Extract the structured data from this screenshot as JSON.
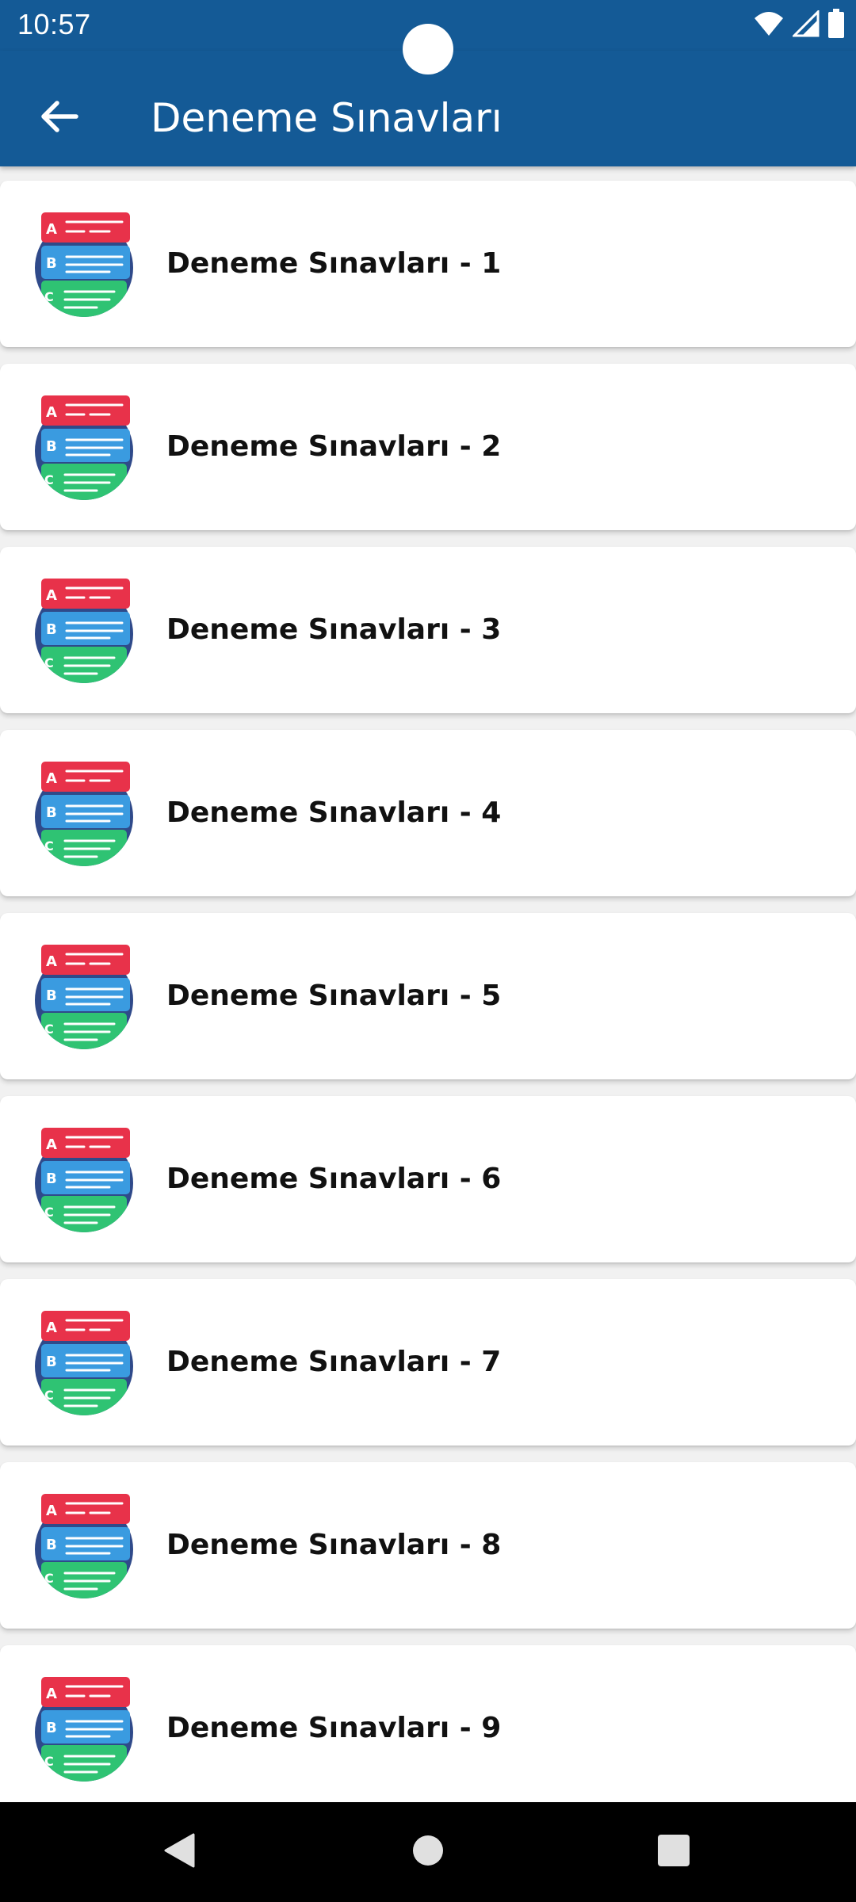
{
  "status_bar": {
    "time": "10:57",
    "icons": [
      "wifi-icon",
      "cell-signal-icon",
      "battery-icon"
    ]
  },
  "app_bar": {
    "title": "Deneme Sınavları",
    "back_icon": "arrow-left-icon",
    "background_color": "#145a96"
  },
  "list": {
    "items": [
      {
        "label": "Deneme Sınavları - 1",
        "icon": "quiz-abc-icon"
      },
      {
        "label": "Deneme Sınavları - 2",
        "icon": "quiz-abc-icon"
      },
      {
        "label": "Deneme Sınavları - 3",
        "icon": "quiz-abc-icon"
      },
      {
        "label": "Deneme Sınavları - 4",
        "icon": "quiz-abc-icon"
      },
      {
        "label": "Deneme Sınavları - 5",
        "icon": "quiz-abc-icon"
      },
      {
        "label": "Deneme Sınavları - 6",
        "icon": "quiz-abc-icon"
      },
      {
        "label": "Deneme Sınavları - 7",
        "icon": "quiz-abc-icon"
      },
      {
        "label": "Deneme Sınavları - 8",
        "icon": "quiz-abc-icon"
      },
      {
        "label": "Deneme Sınavları - 9",
        "icon": "quiz-abc-icon"
      }
    ]
  },
  "icon_colors": {
    "circle": "#2f4a8a",
    "a_card": "#e8324a",
    "b_card": "#3a9be0",
    "c_card": "#2fc373"
  },
  "nav_bar": {
    "buttons": [
      "back-triangle-icon",
      "home-circle-icon",
      "recents-square-icon"
    ]
  }
}
